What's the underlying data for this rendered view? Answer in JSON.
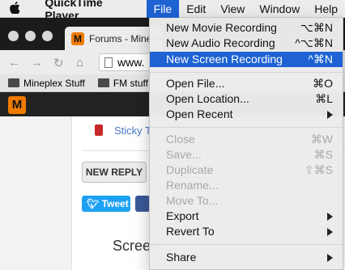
{
  "menubar": {
    "apple_icon": "apple-logo-icon",
    "app_name": "QuickTime Player",
    "items": [
      "File",
      "Edit",
      "View",
      "Window",
      "Help"
    ]
  },
  "browser": {
    "tab_title": "Forums - Mineplex",
    "url_partial": "www.",
    "bookmarks": [
      "Mineplex Stuff",
      "FM stuff"
    ],
    "content": {
      "sticky_text": "Sticky T",
      "new_reply": "NEW REPLY",
      "tweet": "Tweet",
      "partial_heading": "Screen"
    }
  },
  "file_menu": {
    "new_movie": {
      "label": "New Movie Recording",
      "shortcut": "⌥⌘N"
    },
    "new_audio": {
      "label": "New Audio Recording",
      "shortcut": "^⌥⌘N"
    },
    "new_screen": {
      "label": "New Screen Recording",
      "shortcut": "^⌘N"
    },
    "open_file": {
      "label": "Open File...",
      "shortcut": "⌘O"
    },
    "open_location": {
      "label": "Open Location...",
      "shortcut": "⌘L"
    },
    "open_recent": {
      "label": "Open Recent"
    },
    "close": {
      "label": "Close",
      "shortcut": "⌘W"
    },
    "save": {
      "label": "Save...",
      "shortcut": "⌘S"
    },
    "duplicate": {
      "label": "Duplicate",
      "shortcut": "⇧⌘S"
    },
    "rename": {
      "label": "Rename..."
    },
    "move_to": {
      "label": "Move To..."
    },
    "export": {
      "label": "Export"
    },
    "revert_to": {
      "label": "Revert To"
    },
    "share": {
      "label": "Share"
    }
  },
  "colors": {
    "highlight": "#1e62d3",
    "disabled_text": "#a8a8a8"
  }
}
